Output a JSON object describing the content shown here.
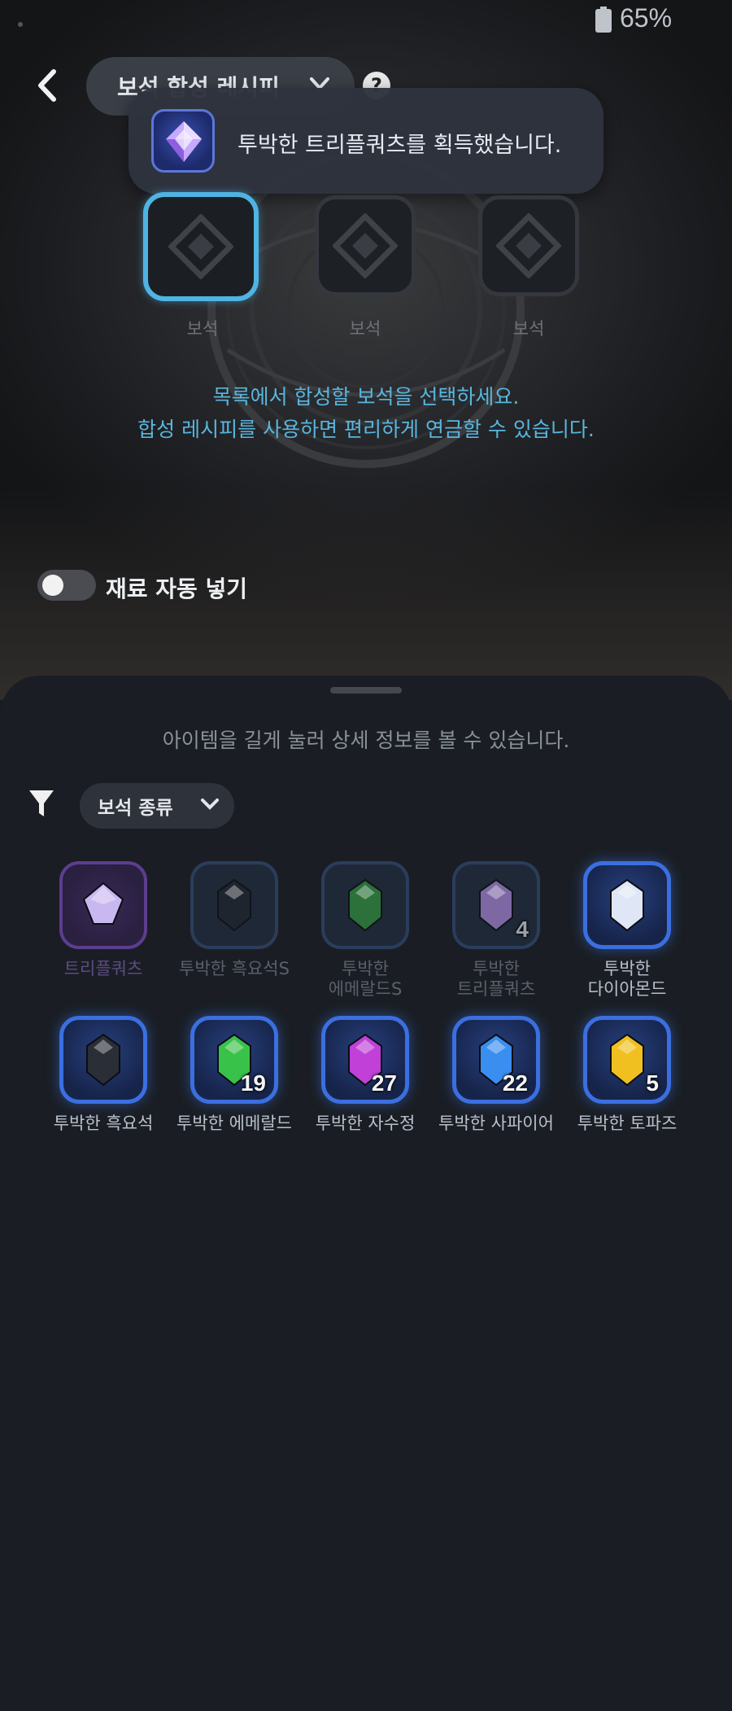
{
  "status": {
    "battery": "65%"
  },
  "header": {
    "recipe_dropdown": "보석 합성 레시피",
    "help": "?"
  },
  "toast": {
    "message": "투박한 트리플쿼츠를 획득했습니다."
  },
  "slots": [
    {
      "label": "보석"
    },
    {
      "label": "보석"
    },
    {
      "label": "보석"
    }
  ],
  "hints": [
    "목록에서 합성할 보석을 선택하세요.",
    "합성 레시피를 사용하면 편리하게 연금할 수 있습니다."
  ],
  "auto_insert": {
    "label": "재료 자동 넣기",
    "enabled": false
  },
  "sheet": {
    "hint": "아이템을 길게 눌러 상세 정보를 볼 수 있습니다.",
    "filter": {
      "label": "보석 종류"
    },
    "items": [
      {
        "name": "트리플쿼츠",
        "count": "",
        "style": "purple",
        "gem": "#c9b8f0"
      },
      {
        "name": "투박한 흑요석S",
        "count": "",
        "style": "dim",
        "gem": "#20242c"
      },
      {
        "name": "투박한\n에메랄드S",
        "count": "",
        "style": "dim",
        "gem": "#2f8a3a"
      },
      {
        "name": "투박한\n트리플쿼츠",
        "count": "4",
        "style": "dim",
        "gem": "#9d7ec8"
      },
      {
        "name": "투박한\n다이아몬드",
        "count": "",
        "style": "blue",
        "gem": "#dfe6f5"
      },
      {
        "name": "투박한 흑요석",
        "count": "",
        "style": "blue",
        "gem": "#2a2e36"
      },
      {
        "name": "투박한 에메랄드",
        "count": "19",
        "style": "blue",
        "gem": "#39c24a"
      },
      {
        "name": "투박한 자수정",
        "count": "27",
        "style": "blue",
        "gem": "#c040d8"
      },
      {
        "name": "투박한 사파이어",
        "count": "22",
        "style": "blue",
        "gem": "#3a8ef0"
      },
      {
        "name": "투박한 토파즈",
        "count": "5",
        "style": "blue",
        "gem": "#f0c020"
      }
    ]
  }
}
